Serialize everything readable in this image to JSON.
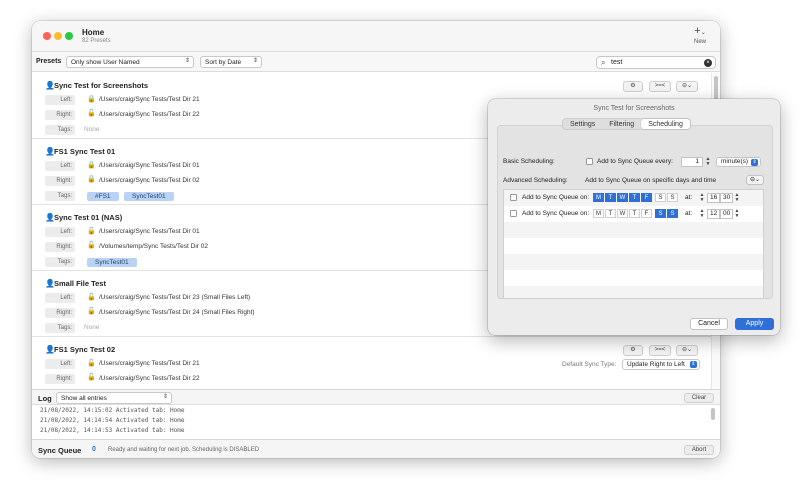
{
  "window": {
    "title": "Home",
    "subtitle": "82 Presets",
    "new_label": "New",
    "new_icon": "+",
    "new_chevron": "⌄"
  },
  "toolbar": {
    "presets_label": "Presets",
    "filter_value": "Only show User Named",
    "sort_value": "Sort by Date",
    "search_value": "test"
  },
  "presets": [
    {
      "name": "Sync Test for Screenshots",
      "left_label": "Left:",
      "left_path": "/Users/craig/Sync Tests/Test Dir 21",
      "right_label": "Right:",
      "right_path": "/Users/craig/Sync Tests/Test Dir 22",
      "tags_label": "Tags:",
      "tags_none": "None"
    },
    {
      "name": "FS1 Sync Test 01",
      "left_label": "Left:",
      "left_path": "/Users/craig/Sync Tests/Test Dir 01",
      "right_label": "Right:",
      "right_path": "/Users/craig/Sync Tests/Test Dir 02",
      "tags_label": "Tags:",
      "tag1": "#FS1",
      "tag2": "SyncTest01"
    },
    {
      "name": "Sync Test 01 (NAS)",
      "left_label": "Left:",
      "left_path": "/Users/craig/Sync Tests/Test Dir 01",
      "right_label": "Right:",
      "right_path": "/Volumes/temp/Sync Tests/Test Dir 02",
      "tags_label": "Tags:",
      "tag1": "SyncTest01"
    },
    {
      "name": "Small File Test",
      "left_label": "Left:",
      "left_path": "/Users/craig/Sync Tests/Test Dir 23 (Small Files Left)",
      "right_label": "Right:",
      "right_path": "/Users/craig/Sync Tests/Test Dir 24 (Small Files Right)",
      "tags_label": "Tags:",
      "tags_none": "None"
    },
    {
      "name": "FS1 Sync Test 02",
      "left_label": "Left:",
      "left_path": "/Users/craig/Sync Tests/Test Dir 21",
      "right_label": "Right:",
      "right_path": "/Users/craig/Sync Tests/Test Dir 22",
      "sync_type_label": "Default Sync Type:",
      "sync_type_value": "Update Right to Left"
    }
  ],
  "row_buttons": {
    "gear": "⚙",
    "compare": ">=<",
    "menu": "⊖⌄"
  },
  "log": {
    "title": "Log",
    "filter_value": "Show all entries",
    "clear_label": "Clear",
    "lines": [
      "21/08/2022, 14:15:02  Activated tab: Home",
      "21/08/2022, 14:14:54  Activated tab: Home",
      "21/08/2022, 14:14:53  Activated tab: Home"
    ]
  },
  "status": {
    "queue_label": "Sync Queue",
    "queue_count": "0",
    "message": "Ready and waiting for next job.  Scheduling is DISABLED",
    "abort_label": "Abort"
  },
  "popover": {
    "title": "Sync Test for Screenshots",
    "tabs": [
      "Settings",
      "Filtering",
      "Scheduling"
    ],
    "selected_tab": "Scheduling",
    "basic_label": "Basic Scheduling:",
    "basic_checkbox_label": "Add to Sync Queue every:",
    "basic_value": "1",
    "basic_unit": "minute(s)",
    "advanced_label": "Advanced Scheduling:",
    "advanced_desc": "Add to Sync Queue on specific days and time",
    "adv_row_label": "Add to Sync Queue on:",
    "at_label": "at:",
    "days": [
      "M",
      "T",
      "W",
      "T",
      "F",
      "S",
      "S"
    ],
    "row1_on": [
      true,
      true,
      true,
      true,
      true,
      false,
      false
    ],
    "row1_hour": "16",
    "row1_min": "30",
    "row2_on": [
      false,
      false,
      false,
      false,
      false,
      true,
      true
    ],
    "row2_hour": "12",
    "row2_min": "00",
    "cancel_label": "Cancel",
    "apply_label": "Apply",
    "accent": "#2f6fd8"
  }
}
